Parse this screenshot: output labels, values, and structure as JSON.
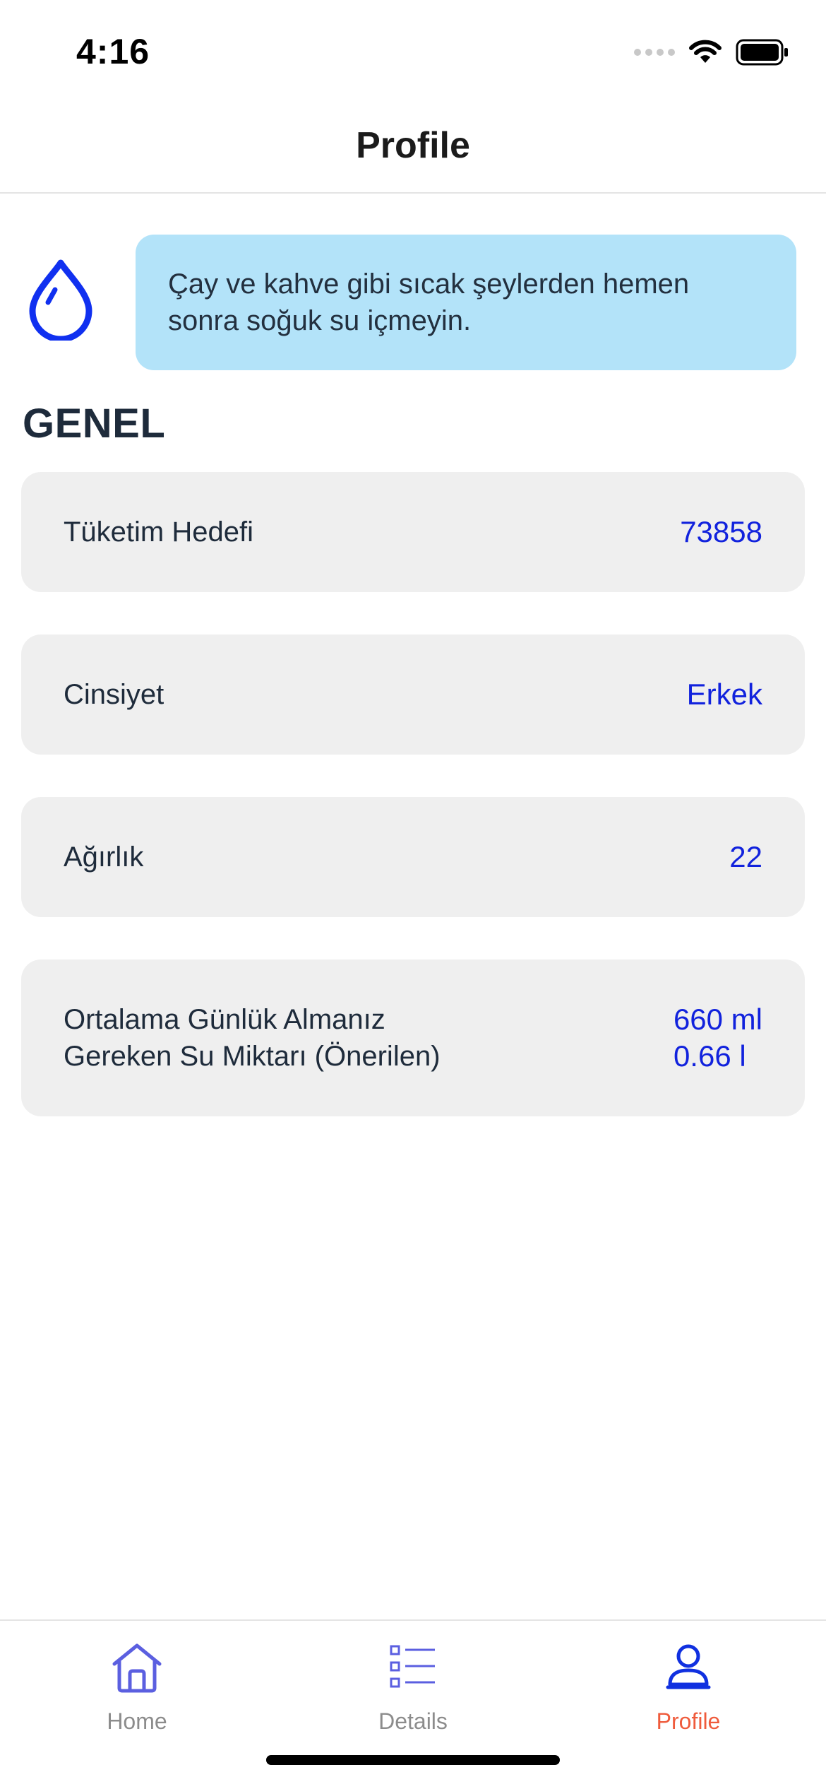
{
  "status_bar": {
    "time": "4:16"
  },
  "nav": {
    "title": "Profile"
  },
  "tip": {
    "icon": "water-drop-icon",
    "text": "Çay ve kahve gibi sıcak şeylerden hemen sonra soğuk su içmeyin."
  },
  "section": {
    "title": "GENEL"
  },
  "rows": [
    {
      "label": "Tüketim Hedefi",
      "value": "73858"
    },
    {
      "label": "Cinsiyet",
      "value": "Erkek"
    },
    {
      "label": "Ağırlık",
      "value": "22"
    },
    {
      "label_line1": "Ortalama Günlük Almanız",
      "label_line2": "Gereken Su Miktarı (Önerilen)",
      "value_line1": "660 ml",
      "value_line2": "0.66 l"
    }
  ],
  "tabs": [
    {
      "label": "Home",
      "icon": "house-icon"
    },
    {
      "label": "Details",
      "icon": "list-icon"
    },
    {
      "label": "Profile",
      "icon": "person-icon",
      "active": true
    }
  ],
  "colors": {
    "accent": "#1122dd",
    "active_tab": "#ef5b3c",
    "tip_bg": "#b3e3f9",
    "card_bg": "#efefef"
  }
}
